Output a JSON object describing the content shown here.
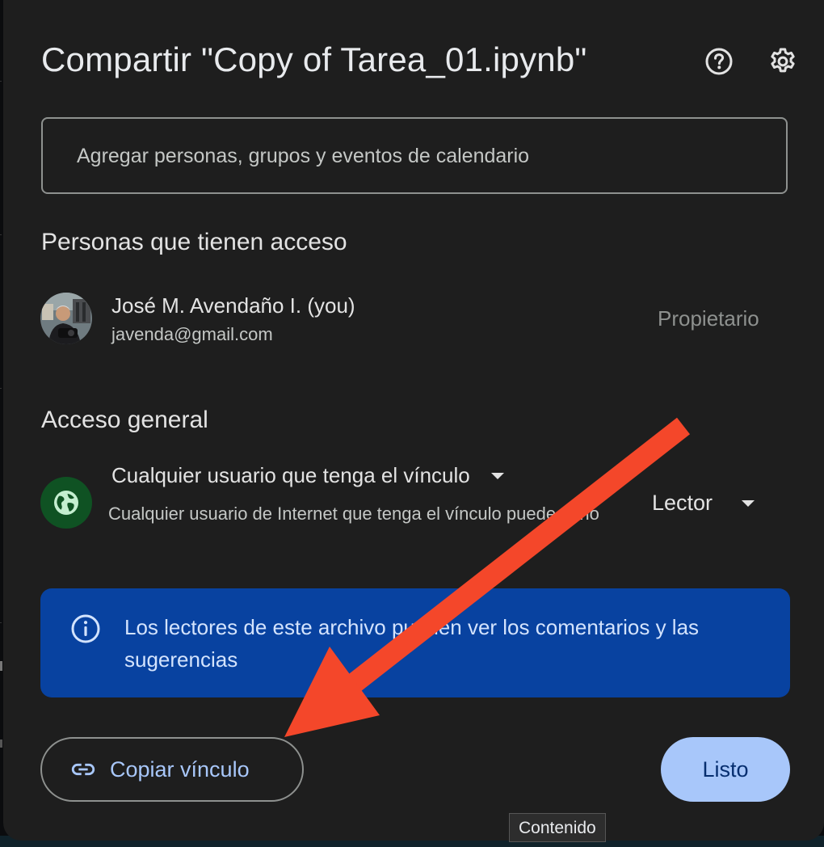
{
  "dialog": {
    "title": "Compartir \"Copy of Tarea_01.ipynb\"",
    "help_icon": "help-circle-icon",
    "settings_icon": "gear-icon"
  },
  "search": {
    "placeholder": "Agregar personas, grupos y eventos de calendario",
    "value": ""
  },
  "people": {
    "heading": "Personas que tienen acceso",
    "items": [
      {
        "name": "José M. Avendaño I. (you)",
        "email": "javenda@gmail.com",
        "role": "Propietario"
      }
    ]
  },
  "general_access": {
    "heading": "Acceso general",
    "icon": "globe-icon",
    "scope_label": "Cualquier usuario que tenga el vínculo",
    "description": "Cualquier usuario de Internet que tenga el vínculo puede verlo",
    "role_label": "Lector"
  },
  "info_banner": {
    "icon": "info-icon",
    "text": "Los lectores de este archivo pueden ver los comentarios y las sugerencias"
  },
  "footer": {
    "copy_link_label": "Copiar vínculo",
    "copy_link_icon": "link-icon",
    "done_label": "Listo"
  },
  "tooltip": {
    "text": "Contenido"
  },
  "colors": {
    "dialog_bg": "#1e1e1e",
    "banner_bg": "#0842a0",
    "primary_button": "#a8c7fa",
    "globe_badge": "#0f5223",
    "annotation_arrow": "#f4472a"
  }
}
